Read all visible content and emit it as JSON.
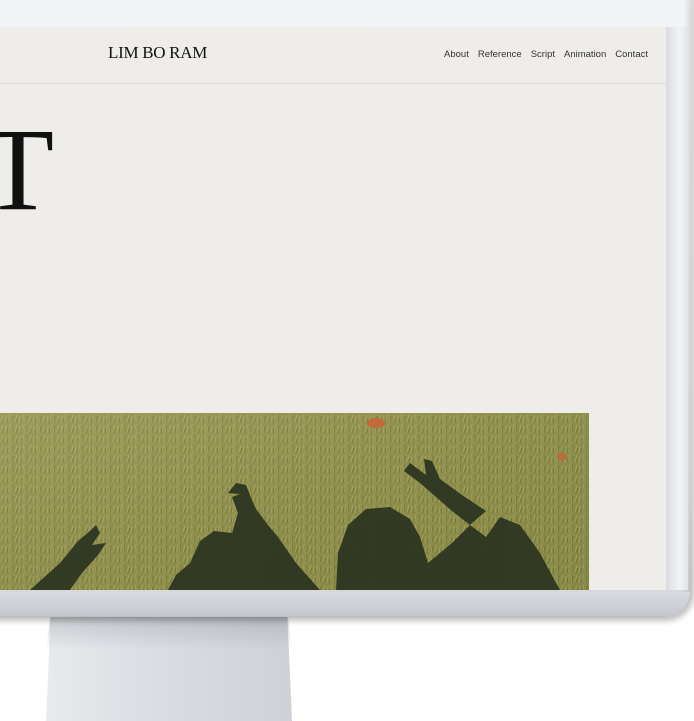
{
  "site": {
    "logo": "LIM BO RAM"
  },
  "nav": {
    "items": [
      {
        "label": "About"
      },
      {
        "label": "Reference"
      },
      {
        "label": "Script"
      },
      {
        "label": "Animation"
      },
      {
        "label": "Contact"
      }
    ]
  },
  "hero": {
    "headline_fragment": "T",
    "photo_description_icon": "grass-shadows-photo"
  },
  "colors": {
    "screen_background": "#efedea",
    "text": "#111111",
    "bezel": "#e6e7eb"
  }
}
